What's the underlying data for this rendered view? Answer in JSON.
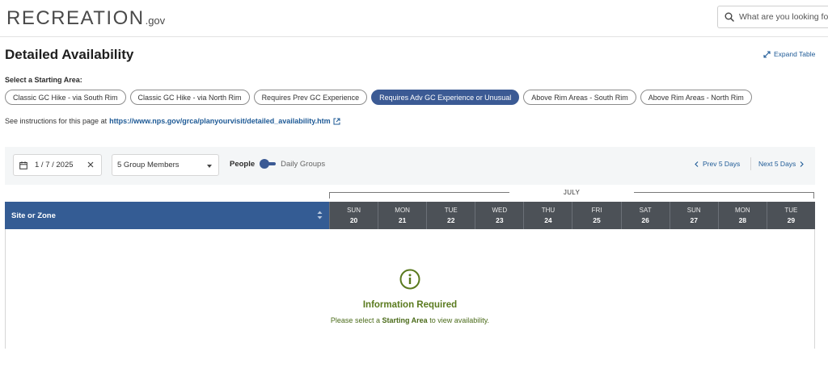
{
  "header": {
    "logo_main": "RECREATION",
    "logo_suffix": ".gov",
    "search_placeholder": "What are you looking for?"
  },
  "page": {
    "title": "Detailed Availability",
    "expand_label": "Expand Table",
    "starting_area_label": "Select a Starting Area:",
    "starting_areas": [
      {
        "label": "Classic GC Hike - via South Rim",
        "active": false
      },
      {
        "label": "Classic GC Hike - via North Rim",
        "active": false
      },
      {
        "label": "Requires Prev GC Experience",
        "active": false
      },
      {
        "label": "Requires Adv GC Experience or Unusual",
        "active": true
      },
      {
        "label": "Above Rim Areas - South Rim",
        "active": false
      },
      {
        "label": "Above Rim Areas - North Rim",
        "active": false
      }
    ],
    "instructions_prefix": "See instructions for this page at",
    "instructions_link": "https://www.nps.gov/grca/planyourvisit/detailed_availability.htm"
  },
  "filters": {
    "date_value": "1 / 7 / 2025",
    "group_members": "5 Group Members",
    "toggle_left": "People",
    "toggle_right": "Daily Groups",
    "prev_label": "Prev 5 Days",
    "next_label": "Next 5 Days"
  },
  "table": {
    "month": "JULY",
    "site_header": "Site or Zone",
    "days": [
      {
        "dow": "SUN",
        "num": "20"
      },
      {
        "dow": "MON",
        "num": "21"
      },
      {
        "dow": "TUE",
        "num": "22"
      },
      {
        "dow": "WED",
        "num": "23"
      },
      {
        "dow": "THU",
        "num": "24"
      },
      {
        "dow": "FRI",
        "num": "25"
      },
      {
        "dow": "SAT",
        "num": "26"
      },
      {
        "dow": "SUN",
        "num": "27"
      },
      {
        "dow": "MON",
        "num": "28"
      },
      {
        "dow": "TUE",
        "num": "29"
      }
    ]
  },
  "empty_state": {
    "title": "Information Required",
    "text_prefix": "Please select a",
    "text_bold": "Starting Area",
    "text_suffix": "to view availability."
  },
  "colors": {
    "accent_blue": "#345c94",
    "active_pill": "#3b5a94",
    "link": "#1e5a96",
    "info_green": "#5a7a1e",
    "day_header": "#4c5157"
  }
}
